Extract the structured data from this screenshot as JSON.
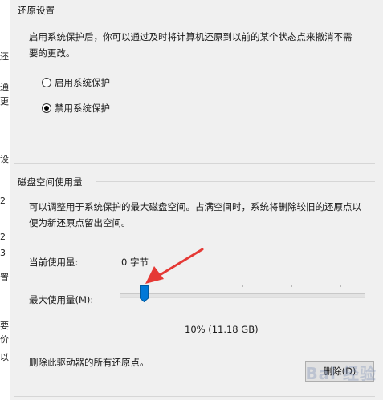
{
  "back_window_fragments": [
    "还",
    "通",
    "更",
    "设",
    "2",
    "2",
    "3",
    "置",
    "要",
    "价",
    "以"
  ],
  "restore_settings": {
    "title": "还原设置",
    "description": "启用系统保护后，你可以通过及时将计算机还原到以前的某个状态点来撤消不需要的更改。",
    "options": [
      {
        "label": "启用系统保护",
        "selected": false
      },
      {
        "label": "禁用系统保护",
        "selected": true
      }
    ]
  },
  "disk_usage": {
    "title": "磁盘空间使用量",
    "description": "可以调整用于系统保护的最大磁盘空间。占满空间时，系统将删除较旧的还原点以便为新还原点留出空间。",
    "current_label": "当前使用量:",
    "current_value": "0 字节",
    "max_label": "最大使用量(M):",
    "slider_fraction": 0.1,
    "slider_readout": "10% (11.18 GB)"
  },
  "delete_section": {
    "text": "删除此驱动器的所有还原点。",
    "button_label": "删除(D)"
  },
  "annotation_color": "#e53935",
  "accent_color": "#0078d7",
  "watermark_text": "Bai 经验"
}
